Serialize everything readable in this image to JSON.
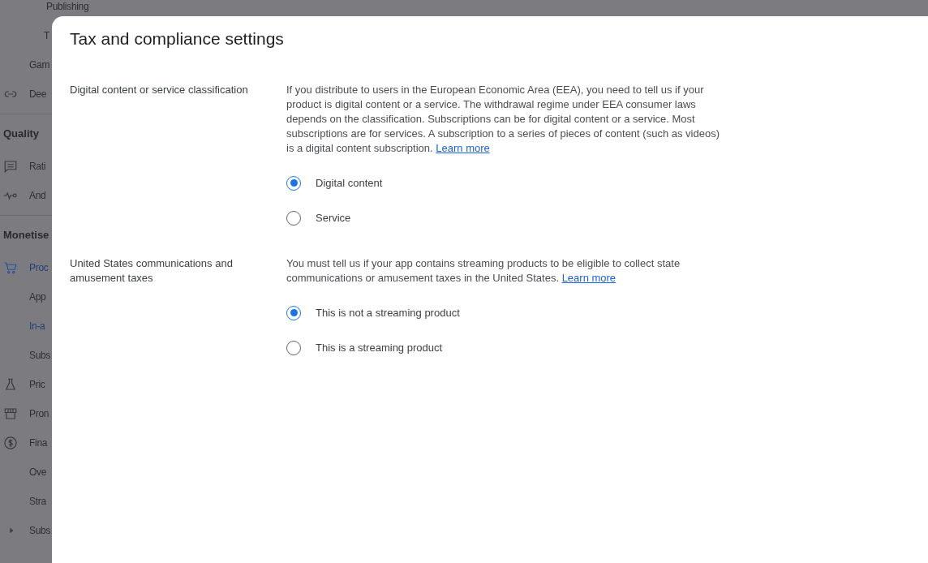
{
  "sidebar": {
    "items": [
      {
        "kind": "subitem",
        "label": "Publishing",
        "selected": false
      },
      {
        "kind": "subitem",
        "label": "T",
        "selected": false
      },
      {
        "kind": "item",
        "label": "Gam",
        "selected": false
      },
      {
        "kind": "item",
        "label": "Dee",
        "selected": false
      },
      {
        "kind": "section",
        "label": "Quality"
      },
      {
        "kind": "item",
        "label": "Rati",
        "selected": false
      },
      {
        "kind": "item",
        "label": "And",
        "selected": false
      },
      {
        "kind": "section",
        "label": "Monetise"
      },
      {
        "kind": "item",
        "label": "Proc",
        "selected": true
      },
      {
        "kind": "item",
        "label": "App",
        "selected": false
      },
      {
        "kind": "item",
        "label": "In-a",
        "selected": true
      },
      {
        "kind": "item",
        "label": "Subs",
        "selected": false
      },
      {
        "kind": "item",
        "label": "Pric",
        "selected": false
      },
      {
        "kind": "item",
        "label": "Pron",
        "selected": false
      },
      {
        "kind": "item",
        "label": "Fina",
        "selected": false
      },
      {
        "kind": "item",
        "label": "Ove",
        "selected": false
      },
      {
        "kind": "item",
        "label": "Stra",
        "selected": false
      },
      {
        "kind": "expander",
        "label": "Subs",
        "selected": false
      }
    ]
  },
  "dialog": {
    "title": "Tax and compliance settings",
    "sections": [
      {
        "label": "Digital content or service classification",
        "description": "If you distribute to users in the European Economic Area (EEA), you need to tell us if your product is digital content or a service. The withdrawal regime under EEA consumer laws depends on the classification. Subscriptions can be for digital content or a service. Most subscriptions are for services. A subscription to a series of pieces of content (such as videos) is a digital content subscription.",
        "link": "Learn more",
        "options": [
          {
            "label": "Digital content",
            "selected": true
          },
          {
            "label": "Service",
            "selected": false
          }
        ]
      },
      {
        "label": "United States communications and amusement taxes",
        "description": "You must tell us if your app contains streaming products to be eligible to collect state communications or amusement taxes in the United States.",
        "link": "Learn more",
        "options": [
          {
            "label": "This is not a streaming product",
            "selected": true
          },
          {
            "label": "This is a streaming product",
            "selected": false
          }
        ]
      }
    ]
  }
}
